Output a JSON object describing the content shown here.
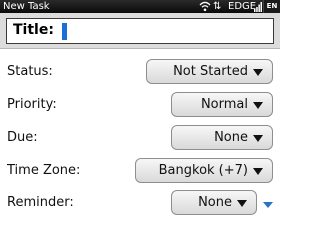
{
  "status_bar": {
    "app_title": "New Task",
    "network": "EDGE",
    "language": "EN",
    "wifi_icon": "wifi-icon",
    "signal_icon": "signal-bars-icon"
  },
  "title_field": {
    "label": "Title:",
    "value": ""
  },
  "form": {
    "status": {
      "label": "Status:",
      "value": "Not Started"
    },
    "priority": {
      "label": "Priority:",
      "value": "Normal"
    },
    "due": {
      "label": "Due:",
      "value": "None"
    },
    "time_zone": {
      "label": "Time Zone:",
      "value": "Bangkok (+7)"
    },
    "reminder": {
      "label": "Reminder:",
      "value": "None"
    }
  },
  "colors": {
    "caret": "#1b6fd8",
    "scroll_indicator": "#2a72c9"
  }
}
